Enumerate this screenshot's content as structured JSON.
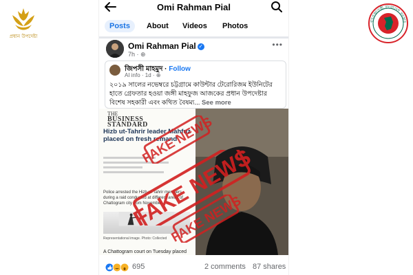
{
  "colors": {
    "accent": "#1877f2",
    "stamp_red": "#d22020",
    "emblem_green": "#006a4e",
    "emblem_red": "#d8232a",
    "gold": "#d4a017"
  },
  "logos": {
    "left_emblem_text": "প্রধান উপদেষ্টা",
    "right_emblem_text": "গণপ্রজাতন্ত্রী বাংলাদেশ সরকার"
  },
  "topbar": {
    "back_icon": "back-arrow-icon",
    "page_name": "Omi Rahman Pial",
    "search_icon": "search-icon"
  },
  "tabs": [
    {
      "label": "Posts"
    },
    {
      "label": "About"
    },
    {
      "label": "Videos"
    },
    {
      "label": "Photos"
    }
  ],
  "post": {
    "author": "Omi Rahman Pial",
    "verified_mark": "✓",
    "time": "7h · ⊕",
    "more": "•••"
  },
  "shared": {
    "author": "জিপসী মাহমুদ",
    "separator": " · ",
    "follow": "Follow",
    "meta": "AI info · 1d · ⊕",
    "text": "২০১৯ সালের নভেম্বরে চট্টগ্রামে কাউন্টার টেরোরিজম ইউনিটের হাতে গ্রেফতার হওয়া জঙ্গী মাহফুজ আজকের প্রধান উপদেষ্টার বিশেষ সহকারী এবং কথিত বৈষম্য...",
    "see_more": " See more"
  },
  "news": {
    "brand_small": "THE",
    "brand_big": "BUSINESS",
    "brand_big2": "STANDARD",
    "headline": "Hizb ut-Tahrir leader Mahfuz placed on fresh remand",
    "body": "Police arrested the Hizb ut-Tahrir members during a raid conducted at different areas of Chattogram city from November",
    "caption": "Representational image. Photo: Collected",
    "court_line": "A Chattogram court on Tuesday placed"
  },
  "stamp": {
    "text": "FAKE NEWS"
  },
  "reactions": {
    "count": "695",
    "comments": "2 comments",
    "shares": "87 shares"
  }
}
